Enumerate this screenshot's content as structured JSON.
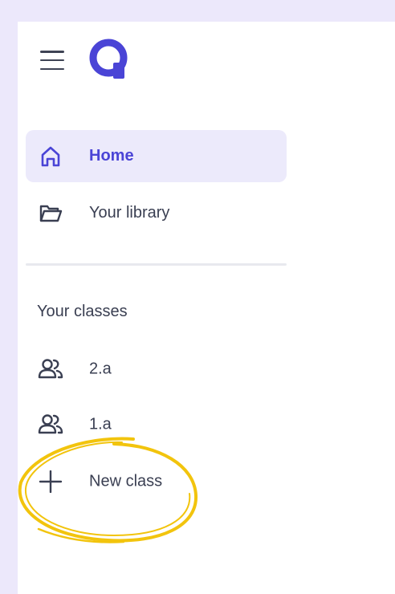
{
  "sidebar": {
    "menu_icon": "hamburger-menu-icon",
    "logo_icon": "quizizz-q-logo",
    "nav": [
      {
        "label": "Home",
        "icon": "home-icon",
        "active": true
      },
      {
        "label": "Your library",
        "icon": "folder-open-icon",
        "active": false
      }
    ],
    "classes_heading": "Your classes",
    "classes": [
      {
        "label": "2.a",
        "icon": "users-icon"
      },
      {
        "label": "1.a",
        "icon": "users-icon"
      }
    ],
    "new_class": {
      "label": "New class",
      "icon": "plus-icon"
    }
  },
  "colors": {
    "accent": "#4a44d6",
    "active_background": "#eceafb",
    "text": "#3a3f52",
    "frame": "#ece8fb",
    "highlight": "#f2c40d"
  }
}
